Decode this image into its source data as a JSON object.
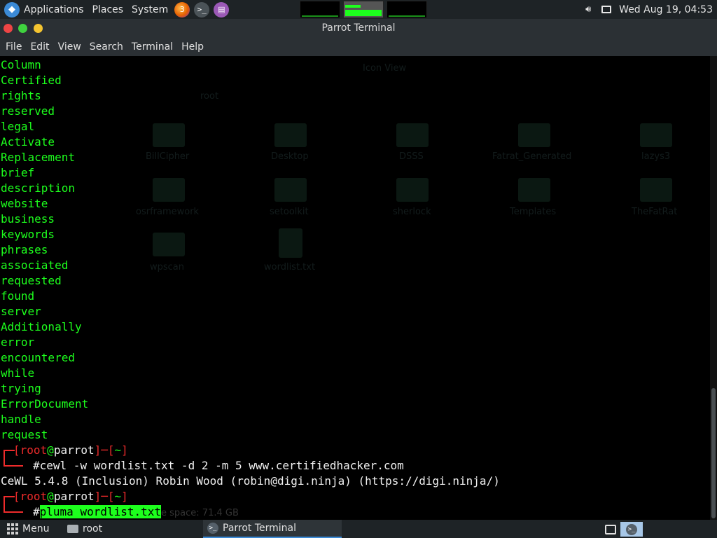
{
  "top_panel": {
    "applications": "Applications",
    "places": "Places",
    "system": "System",
    "firefox_badge": "3",
    "terminal_glyph": ">_",
    "clock": "Wed Aug 19, 04:53",
    "volume_icon": "volume-icon",
    "display_icon": "display-icon"
  },
  "window": {
    "title": "Parrot Terminal"
  },
  "menubar": [
    {
      "label": "File"
    },
    {
      "label": "Edit"
    },
    {
      "label": "View"
    },
    {
      "label": "Search"
    },
    {
      "label": "Terminal"
    },
    {
      "label": "Help"
    }
  ],
  "terminal": {
    "output_words": [
      "Column",
      "Certified",
      "rights",
      "reserved",
      "legal",
      "Activate",
      "Replacement",
      "brief",
      "description",
      "website",
      "business",
      "keywords",
      "phrases",
      "associated",
      "requested",
      "found",
      "server",
      "Additionally",
      "error",
      "encountered",
      "while",
      "trying",
      "ErrorDocument",
      "handle",
      "request"
    ],
    "prompt1": {
      "open": "[",
      "user": "root",
      "at": "@",
      "host": "parrot",
      "close": "]",
      "dash": "─",
      "dir_open": "[",
      "dir": "~",
      "dir_close": "]",
      "hash": "#",
      "command": "cewl -w wordlist.txt -d 2 -m 5 www.certifiedhacker.com"
    },
    "cewl_output": "CeWL 5.4.8 (Inclusion) Robin Wood (robin@digi.ninja) (https://digi.ninja/)",
    "prompt2": {
      "open": "[",
      "user": "root",
      "at": "@",
      "host": "parrot",
      "close": "]",
      "dash": "─",
      "dir_open": "[",
      "dir": "~",
      "dir_close": "]",
      "hash": "#",
      "command": "pluma wordlist.txt"
    },
    "ghost_file_manager": {
      "breadcrumb": "root",
      "view_mode": "Icon View",
      "zoom": "",
      "items": [
        "BillCipher",
        "Desktop",
        "DSSS",
        "Fatrat_Generated",
        "lazys3",
        "osrframework",
        "setoolkit",
        "sherlock",
        "Templates",
        "TheFatRat",
        "wpscan",
        "wordlist.txt"
      ],
      "free_space": "e space: 71.4 GB"
    }
  },
  "taskbar": {
    "menu": "Menu",
    "folder": "root",
    "active_task": "Parrot Terminal"
  },
  "colors": {
    "terminal_green": "#1dff1d",
    "prompt_red": "#ee2b2b",
    "panel_bg": "#1e2326",
    "accent_blue": "#3b8ad6"
  }
}
